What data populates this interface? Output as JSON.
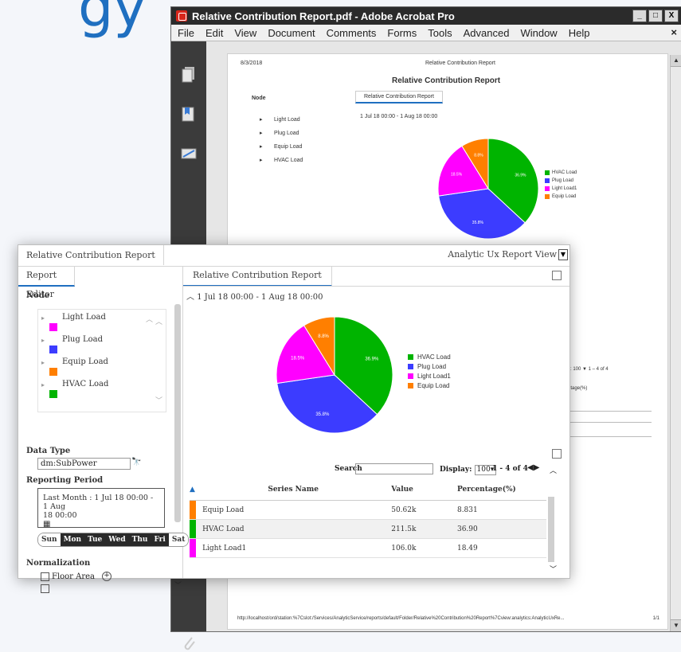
{
  "acrobat": {
    "title": "Relative Contribution Report.pdf - Adobe Acrobat Pro",
    "menu": [
      "File",
      "Edit",
      "View",
      "Document",
      "Comments",
      "Forms",
      "Tools",
      "Advanced",
      "Window",
      "Help"
    ],
    "window_buttons": [
      "_",
      "□",
      "X"
    ],
    "close_x": "×",
    "page": {
      "date": "8/3/2018",
      "header": "Relative Contribution Report",
      "title": "Relative Contribution Report",
      "node_label": "Node",
      "tab": "Relative Contribution Report",
      "range": "1 Jul 18 00:00 - 1 Aug 18 00:00",
      "nodes": [
        "Light Load",
        "Plug Load",
        "Equip Load",
        "HVAC Load"
      ],
      "legend": [
        "HVAC Load",
        "Plug Load",
        "Light Load1",
        "Equip Load"
      ],
      "display": "y: 100 ▼   1 – 4 of 4",
      "percentage": "ntage(%)",
      "footer_url": "http://localhost/ord/station:%7Cslot:/Services/AnalyticService/reports/default/Folder/Relative%20Contribution%20Report%7Cview:analytics:AnalyticUxRe...",
      "page_count": "1/1"
    }
  },
  "report": {
    "top_tab": "Relative Contribution Report",
    "view_selector": "Analytic Ux Report View",
    "left_tab": "Report Editor",
    "right_tab": "Relative Contribution Report",
    "node_section": "Node",
    "nodes": [
      {
        "label": "Light Load",
        "color": "#ff00ff"
      },
      {
        "label": "Plug Load",
        "color": "#3c3cff"
      },
      {
        "label": "Equip Load",
        "color": "#ff7f00"
      },
      {
        "label": "HVAC Load",
        "color": "#00b400"
      }
    ],
    "data_type_section": "Data Type",
    "data_type_value": "dm:SubPower",
    "reporting_period_section": "Reporting Period",
    "reporting_period_line1": "Last Month : 1 Jul 18 00:00 - 1 Aug",
    "reporting_period_line2": "18 00:00",
    "days": [
      {
        "label": "Sun",
        "on": false
      },
      {
        "label": "Mon",
        "on": true
      },
      {
        "label": "Tue",
        "on": true
      },
      {
        "label": "Wed",
        "on": true
      },
      {
        "label": "Thu",
        "on": true
      },
      {
        "label": "Fri",
        "on": true
      },
      {
        "label": "Sat",
        "on": false
      }
    ],
    "normalization_section": "Normalization",
    "floor_area_label": "Floor Area",
    "range_label": "1 Jul 18 00:00 - 1 Aug 18 00:00",
    "search_label": "Search",
    "display_label": "Display:",
    "display_value": "100",
    "pagination": "1 - 4 of 4",
    "table": {
      "headers": [
        "Series Name",
        "Value",
        "Percentage(%)"
      ],
      "rows": [
        {
          "name": "Equip Load",
          "value": "50.62k",
          "pct": "8.831",
          "color": "#ff7f00"
        },
        {
          "name": "HVAC Load",
          "value": "211.5k",
          "pct": "36.90",
          "color": "#00b400"
        },
        {
          "name": "Light Load1",
          "value": "106.0k",
          "pct": "18.49",
          "color": "#ff00ff"
        }
      ]
    }
  },
  "chart_data": {
    "type": "pie",
    "slices": [
      {
        "name": "HVAC Load",
        "value": 36.9,
        "label": "36.9%",
        "color": "#00b400"
      },
      {
        "name": "Plug Load",
        "value": 35.8,
        "label": "35.8%",
        "color": "#3c3cff"
      },
      {
        "name": "Light Load1",
        "value": 18.5,
        "label": "18.5%",
        "color": "#ff00ff"
      },
      {
        "name": "Equip Load",
        "value": 8.8,
        "label": "8.8%",
        "color": "#ff7f00"
      }
    ],
    "legend": [
      "HVAC Load",
      "Plug Load",
      "Light Load1",
      "Equip Load"
    ],
    "legend_placement": "right"
  }
}
